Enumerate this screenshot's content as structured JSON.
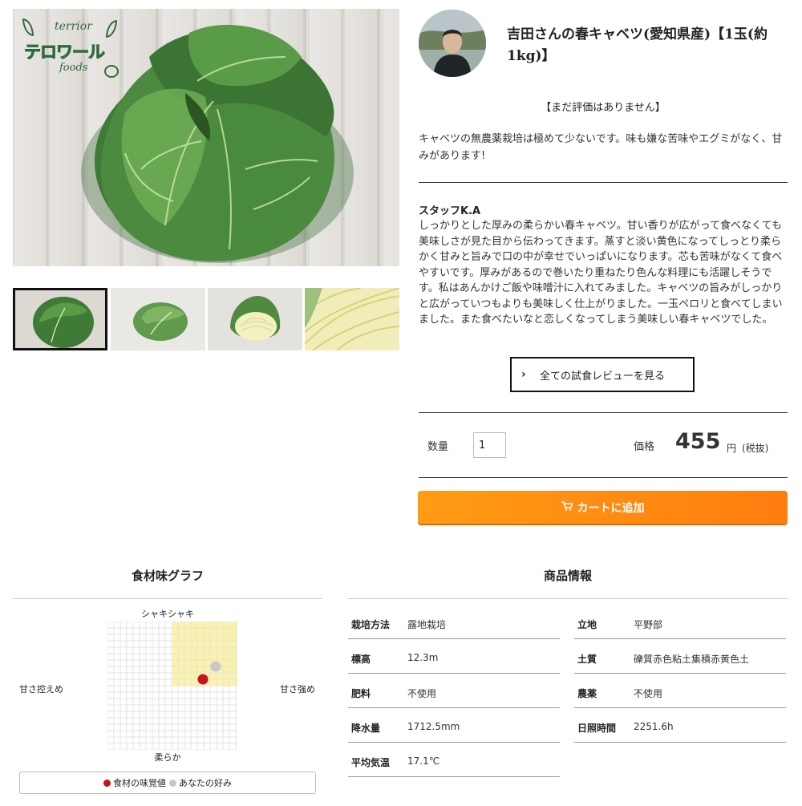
{
  "gallery": {
    "logo": {
      "top": "terrior",
      "main": "テロワール",
      "bottom": "foods"
    },
    "thumbnails": [
      "cabbage-top",
      "cabbage-side",
      "cabbage-cut",
      "cabbage-closeup"
    ]
  },
  "product": {
    "title": "吉田さんの春キャベツ(愛知県産)【1玉(約1kg)】",
    "rating": "【まだ評価はありません】",
    "description": "キャベツの無農薬栽培は極めて少ないです。味も嫌な苦味やエグミがなく、甘みがあります!",
    "review": {
      "author": "スタッフK.A",
      "body": "しっかりとした厚みの柔らかい春キャベツ。甘い香りが広がって食べなくても美味しさが見た目から伝わってきます。蒸すと淡い黄色になってしっとり柔らかく甘みと旨みで口の中が幸せでいっぱいになります。芯も苦味がなくて食べやすいです。厚みがあるので巻いたり重ねたり色んな料理にも活躍しそうです。私はあんかけご飯や味噌汁に入れてみました。キャベツの旨みがしっかりと広がっていつもよりも美味しく仕上がりました。一玉ペロリと食べてしまいました。また食べたいなと恋しくなってしまう美味しい春キャベツでした。"
    },
    "all_reviews_label": "全ての試食レビューを見る",
    "quantity_label": "数量",
    "quantity_value": "1",
    "price_label": "価格",
    "price_value": "455",
    "price_unit": "円",
    "price_tax": "(税抜)",
    "cart_label": "カートに追加",
    "accent_color": "#ff8c10"
  },
  "taste_graph": {
    "title": "食材味グラフ",
    "axis_top": "シャキシャキ",
    "axis_bottom": "柔らか",
    "axis_left": "甘さ控えめ",
    "axis_right": "甘さ強め",
    "legend_ingredient": "食材の味覚値",
    "legend_yours": "あなたの好み",
    "ingredient_color": "#c0161d",
    "yours_color": "#c8c8c8",
    "highlight_color": "#fbf3a6"
  },
  "product_info": {
    "title": "商品情報",
    "left": [
      {
        "key": "栽培方法",
        "value": "露地栽培"
      },
      {
        "key": "標高",
        "value": "12.3m"
      },
      {
        "key": "肥料",
        "value": "不使用"
      },
      {
        "key": "降水量",
        "value": "1712.5mm"
      },
      {
        "key": "平均気温",
        "value": "17.1℃"
      }
    ],
    "right": [
      {
        "key": "立地",
        "value": "平野部"
      },
      {
        "key": "土質",
        "value": "礫質赤色粘土集積赤黄色土"
      },
      {
        "key": "農薬",
        "value": "不使用"
      },
      {
        "key": "日照時間",
        "value": "2251.6h"
      }
    ]
  }
}
